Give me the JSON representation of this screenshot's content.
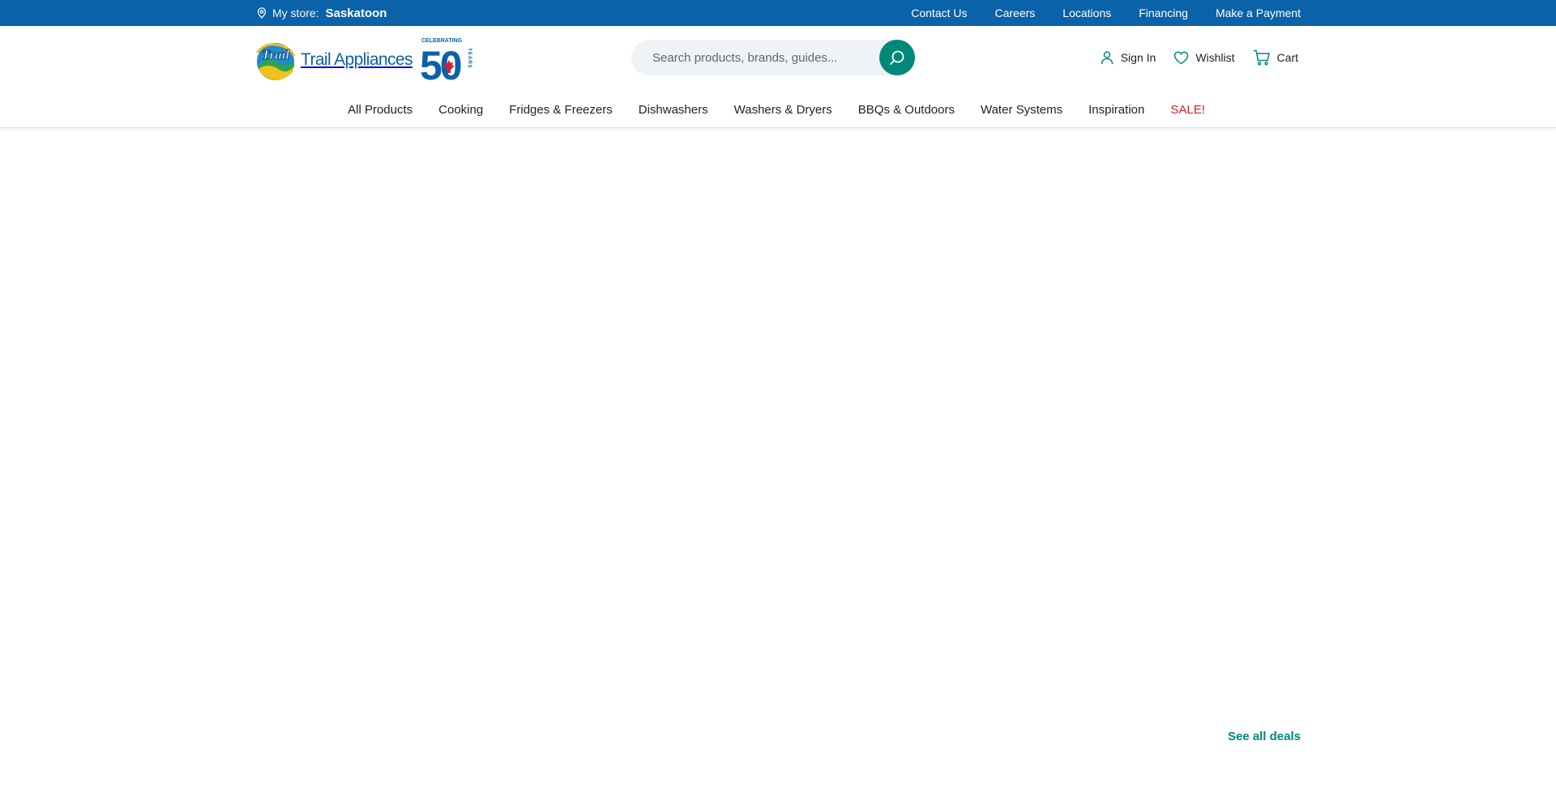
{
  "topbar": {
    "store_label": "My store:",
    "store_name": "Saskatoon",
    "links": [
      "Contact Us",
      "Careers",
      "Locations",
      "Financing",
      "Make a Payment"
    ]
  },
  "header": {
    "logo_text": "Trail Appliances",
    "badge_small_text": "CELEBRATING",
    "badge_number": "50",
    "badge_side_text": "YEARS",
    "search": {
      "placeholder": "Search products, brands, guides..."
    },
    "account": {
      "sign_in": "Sign In",
      "wishlist": "Wishlist",
      "cart": "Cart"
    }
  },
  "nav": {
    "items": [
      "All Products",
      "Cooking",
      "Fridges & Freezers",
      "Dishwashers",
      "Washers & Dryers",
      "BBQs & Outdoors",
      "Water Systems",
      "Inspiration",
      "SALE!"
    ]
  },
  "main": {
    "see_all_deals": "See all deals"
  },
  "colors": {
    "topbar_bg": "#0a62a8",
    "brand_blue": "#0a62a8",
    "accent_teal": "#00897b",
    "sale_red": "#d2202f"
  },
  "icons": {
    "store": "map-pin-icon",
    "search": "search-icon",
    "sign_in": "user-icon",
    "wishlist": "heart-icon",
    "cart": "cart-icon"
  }
}
